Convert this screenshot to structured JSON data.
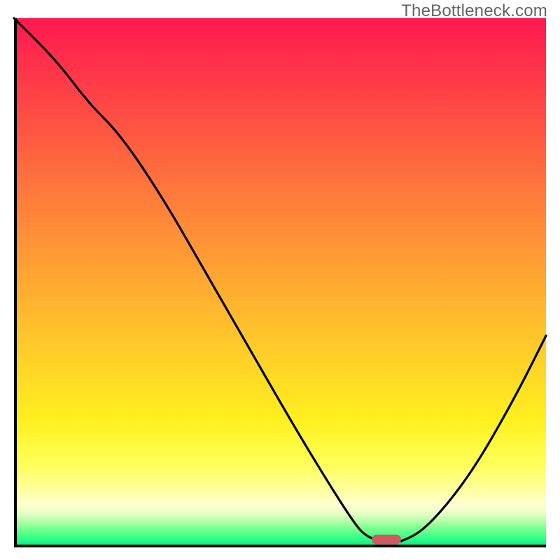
{
  "watermark": "TheBottleneck.com",
  "chart_data": {
    "type": "line",
    "title": "",
    "xlabel": "",
    "ylabel": "",
    "xlim": [
      0,
      100
    ],
    "ylim": [
      0,
      100
    ],
    "grid": false,
    "legend": false,
    "series": [
      {
        "name": "curve",
        "x": [
          0,
          8,
          14,
          20,
          28,
          36,
          44,
          52,
          58,
          63,
          66,
          70,
          73,
          78,
          86,
          94,
          100
        ],
        "y": [
          100,
          92,
          84,
          78,
          66,
          52,
          38,
          24,
          14,
          6,
          2,
          1,
          1,
          4,
          14,
          28,
          40
        ]
      }
    ],
    "marker": {
      "x": 70,
      "y": 1.5
    },
    "background_gradient": {
      "top_color": "#ff1850",
      "mid_color": "#ffd028",
      "bottom_color": "#00e884"
    }
  }
}
